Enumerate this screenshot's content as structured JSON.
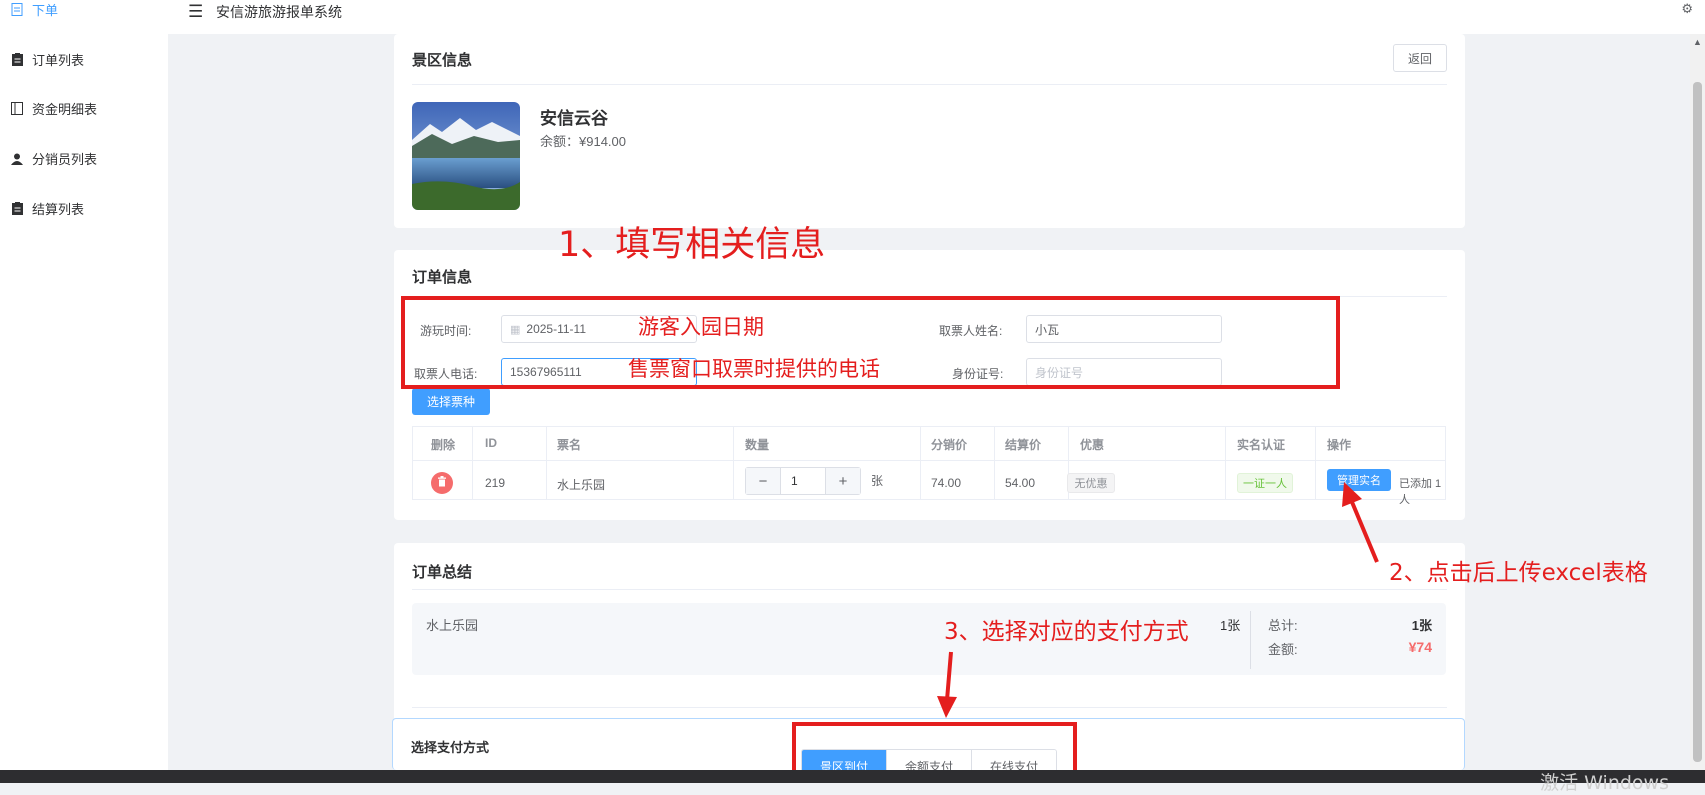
{
  "sidebar": {
    "items": [
      {
        "label": "下单",
        "icon": "document-icon",
        "active": true
      },
      {
        "label": "订单列表",
        "icon": "clipboard-icon",
        "active": false
      },
      {
        "label": "资金明细表",
        "icon": "book-icon",
        "active": false
      },
      {
        "label": "分销员列表",
        "icon": "user-icon",
        "active": false
      },
      {
        "label": "结算列表",
        "icon": "clipboard-icon",
        "active": false
      }
    ]
  },
  "header": {
    "title": "安信游旅游报单系统"
  },
  "scenic": {
    "section_title": "景区信息",
    "back_label": "返回",
    "name": "安信云谷",
    "balance_label": "余额：",
    "balance_value": "¥914.00"
  },
  "order": {
    "section_title": "订单信息",
    "fields": {
      "date_label": "游玩时间:",
      "date_value": "2025-11-11",
      "picker_name_label": "取票人姓名:",
      "picker_name_value": "小瓦",
      "phone_label": "取票人电话:",
      "phone_value": "15367965111",
      "idcard_label": "身份证号:",
      "idcard_placeholder": "身份证号"
    },
    "select_ticket_label": "选择票种",
    "table": {
      "headers": [
        "删除",
        "ID",
        "票名",
        "数量",
        "分销价",
        "结算价",
        "优惠",
        "实名认证",
        "操作"
      ],
      "rows": [
        {
          "id": "219",
          "name": "水上乐园",
          "quantity": "1",
          "unit": "张",
          "distribution_price": "74.00",
          "settlement_price": "54.00",
          "discount": "无优惠",
          "realname": "一证一人",
          "action_label": "管理实名",
          "added_text": "已添加 1 人"
        }
      ]
    }
  },
  "summary": {
    "section_title": "订单总结",
    "item_name": "水上乐园",
    "item_count": "1张",
    "total_label": "总计:",
    "total_value": "1张",
    "amount_label": "金额:",
    "amount_value": "¥74"
  },
  "payment": {
    "section_title": "选择支付方式",
    "tabs": [
      {
        "label": "景区到付",
        "active": true
      },
      {
        "label": "余额支付",
        "active": false
      },
      {
        "label": "在线支付",
        "active": false
      }
    ]
  },
  "annotations": {
    "step1": "1、填写相关信息",
    "date_note": "游客入园日期",
    "phone_note": "售票窗口取票时提供的电话",
    "step2": "2、点击后上传excel表格",
    "step3": "3、选择对应的支付方式"
  },
  "watermark": "激活 Windows",
  "colors": {
    "primary": "#409eff",
    "danger": "#f56c6c",
    "annotation": "#e41e1e",
    "amount": "#f56c6c"
  }
}
